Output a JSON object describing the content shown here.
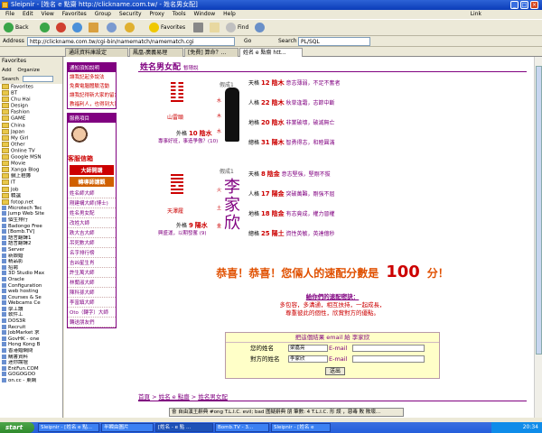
{
  "window": {
    "title": "Sleipnir - [姓名 e 點齋 http://clickname.com.tw/ - 姓名男女配]"
  },
  "menu": {
    "items": [
      "File",
      "Edit",
      "View",
      "Favorites",
      "Group",
      "Security",
      "Proxy",
      "Tools",
      "Window",
      "Help"
    ],
    "link": "Link"
  },
  "toolbar": {
    "back": "Back",
    "favorites": "Favorites",
    "find": "Find"
  },
  "address": {
    "label": "Address",
    "url": "http://clickname.com.tw/cgi-bin/namematch/namematch.cgi",
    "go": "Go",
    "search_label": "Search",
    "search_value": "PL/SQL"
  },
  "tabs": [
    "通訊資料庫設定",
    "鳳凰-廣義易理",
    "[免費] 算命？...",
    "姓名 e 點齋 htt..."
  ],
  "sidebar": {
    "title": "Favorites",
    "add": "Add",
    "organize": "Organize",
    "search": "Search",
    "items": [
      "Favorites",
      "BT",
      "Chu Hai",
      "Design",
      "Fashion",
      "GAME",
      "China",
      "Japan",
      "My Girl",
      "Other",
      "Online TV",
      "Google MSN",
      "Movie",
      "Xanga Blog",
      "網上相簿",
      "IT",
      "Job",
      "精選",
      "fotop.net",
      "Microtech Tec",
      "Jump Web Site",
      "個生排行",
      "Badongo Free",
      "[Bomb.TV]",
      "語言翻譯1",
      "語言翻譯2",
      "Server",
      "新娘婚",
      "精品影",
      "招聘",
      "3D Studio Max",
      "Oracle",
      "Configuration",
      "web hosting",
      "Courses & Se",
      "Webcams Ce",
      "學工讀",
      "軟件工",
      "DOS3R",
      "Recruit",
      "JobMarket 求",
      "GovHK - one",
      "Hong Kong B",
      "香港婚網問",
      "購書資料",
      "迷你論壇",
      "EntFun.COM",
      "GOGOGOO",
      "on.cc - 東網"
    ]
  },
  "leftnav": {
    "box1_title": "通知須知說明",
    "box1_items": [
      "讓我記起多說法",
      "免費電腦體驗活動",
      "讓我記得新大家的留言",
      "教福利人，也得到大家的祝福"
    ],
    "box2_title": "服務項目",
    "ask_label": "客服信箱",
    "link_a": "大師開講",
    "link_b": "轉導師講觀",
    "list": [
      "姓名師大師",
      "剛建構大師(博士)",
      "姓名男女配",
      "改姓大師",
      "跌大吉大師",
      "吊死數大師",
      "名字排行榜",
      "吉凶星生肖",
      "許生萬大師",
      "林蘭淑大師",
      "陳科孫大師",
      "李富鎮大師",
      "Oto（轉字）大師",
      "轉送朋友們"
    ]
  },
  "page": {
    "title": "姓名男女配",
    "subtitle": "暫隱說",
    "person1": {
      "hex_name": "山雷頤",
      "fake": "假成1",
      "wai": "外格",
      "wai_num": "10",
      "wai_el": "陰水",
      "wai_desc": "奧妙非大事，事造業運...",
      "desc_small": "專事好班，事造爭傲？(10)",
      "scores": [
        {
          "label": "天格",
          "num": "12",
          "el": "陰木",
          "desc": "意志薄弱，不足不奮者"
        },
        {
          "label": "人格",
          "num": "22",
          "el": "陰木",
          "desc": "秋草逢霜，志節中斷"
        },
        {
          "label": "地格",
          "num": "20",
          "el": "陰水",
          "desc": "非業破壞，破滅無亡"
        },
        {
          "label": "總格",
          "num": "31",
          "el": "陽木",
          "desc": "智勇得志，和睦圓滿"
        }
      ]
    },
    "person2": {
      "hex_name": "天澤履",
      "fake": "假成1",
      "chars": [
        "李",
        "家",
        "欣"
      ],
      "char_el": [
        "火",
        "土",
        "金"
      ],
      "wai": "外格",
      "wai_num": "9",
      "wai_el": "陽水",
      "desc_small": "興盛運，以期發奮 (9)",
      "scores": [
        {
          "label": "天格",
          "num": "8",
          "el": "陰金",
          "desc": "意志堅強，堅剛不拔"
        },
        {
          "label": "人格",
          "num": "17",
          "el": "陽金",
          "desc": "突破萬難，剛強不屈"
        },
        {
          "label": "地格",
          "num": "18",
          "el": "陰金",
          "desc": "有志竟成，權力晉權"
        },
        {
          "label": "總格",
          "num": "25",
          "el": "陽土",
          "desc": "資性英敏，英達億秒"
        }
      ]
    },
    "congrats_pre": "恭喜！恭喜！您倆人的速配分數是",
    "score": "100",
    "congrats_post": "分！",
    "advice_title": "給你們的速配密訣：",
    "advice_lines": [
      "多包容，多溝通，相互扶持，一起成長，",
      "尊重彼此的個性，欣賞對方的優點。"
    ],
    "email": {
      "title": "把這個結果 email 給 李家欣",
      "your_name_label": "您的姓名",
      "your_name_value": "梁嘉亮",
      "other_name_label": "對方的姓名",
      "other_name_value": "李家欣",
      "email_label": "E-mail",
      "send": "送出"
    },
    "footer": [
      "首頁",
      "姓名 e 點齋",
      "姓名男女配"
    ]
  },
  "ime_bar": "會 自由漢王辭典 #ong T.L.I.C. evil; bad 圍疑辭典 朋 筆數: 4 T.L.I.C. 形 誤 ，惡毒 敗 敗壞...",
  "taskbar": {
    "start": "start",
    "tasks": [
      "Sleipnir - [姓名 e 點...",
      "半瞬由圖片",
      "[姓名 - e 點 ...",
      "Bomb.TV - 3...",
      "Sleipnir - [姓名 e"
    ],
    "clock": "20:34"
  }
}
